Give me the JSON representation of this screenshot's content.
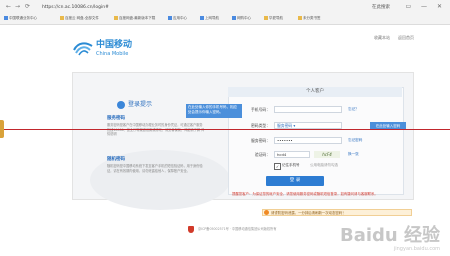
{
  "browser": {
    "url": "https://cn.ac.10086.cn/login#",
    "nav_icons": [
      "←",
      "→",
      "⟳"
    ],
    "search_tab": "在此搜索",
    "window_controls": "▭ — ✕",
    "bookmarks": [
      {
        "label": "中国联通业务中心"
      },
      {
        "label": "百度云 网盘-全部文件"
      },
      {
        "label": "百度网盘-最新版本下载"
      },
      {
        "label": "应用中心"
      },
      {
        "label": "上网导航"
      },
      {
        "label": "网购中心"
      },
      {
        "label": "华夏导航"
      },
      {
        "label": "未分类书签"
      }
    ]
  },
  "header": {
    "logo_cn": "中国移动",
    "logo_en": "China Mobile",
    "top_link_1": "收藏本站",
    "top_link_2": "返回首页"
  },
  "tips": {
    "title": "登录提示",
    "service_title": "服务密码",
    "service_text": "服务密码是客户在中国移动办理业务时的身份凭证，可通过客户服务热线10086、营业厅等渠道设置或修改，请妥善保管，详细请了解 详情说明",
    "random_title": "随机密码",
    "random_text": "随机密码是中国移动系统下发至客户手机的短信验证码，用于身份验证，请在有效期内使用，请勿泄露给他人，保障账户安全。"
  },
  "annotations": {
    "hint_phone": "在此处输入你的手机号码，相应处会提示你输入密码。",
    "hint_password": "在此处输入密码"
  },
  "form": {
    "header": "个人客户",
    "phone_label": "手机号码：",
    "phone_side": "忘记？",
    "password_type_label": "密码类型：",
    "password_type_value": "服务密码",
    "password_label": "服务密码：",
    "password_value": "•••••••",
    "password_side": "忘记密码",
    "captcha_label": "验证码：",
    "captcha_value": "hcd4",
    "captcha_image": "hcF4",
    "captcha_side": "换一张",
    "remember_label": "记住手机号",
    "remember_note": "公用电脑请勿勾选",
    "login_button": "登 录",
    "red_tip": "提醒您客户：为保证您的帐户安全，请您使用服务密码或随机短信登录，如有疑问请与客服联系。"
  },
  "warning": "请谨防密码泄露，一分钟后请刷新一次动态密码！",
  "footer": "京ICP备05002571号 · 中国移动通信集团公司版权所有",
  "watermark": {
    "line1": "Baidu 经验",
    "line2": "jingyan.baidu.com"
  },
  "colors": {
    "brand_blue": "#2b8bd4",
    "login_button": "#2d7cd2",
    "alert_red": "#d23b2f",
    "divider_red": "#c1272d"
  }
}
